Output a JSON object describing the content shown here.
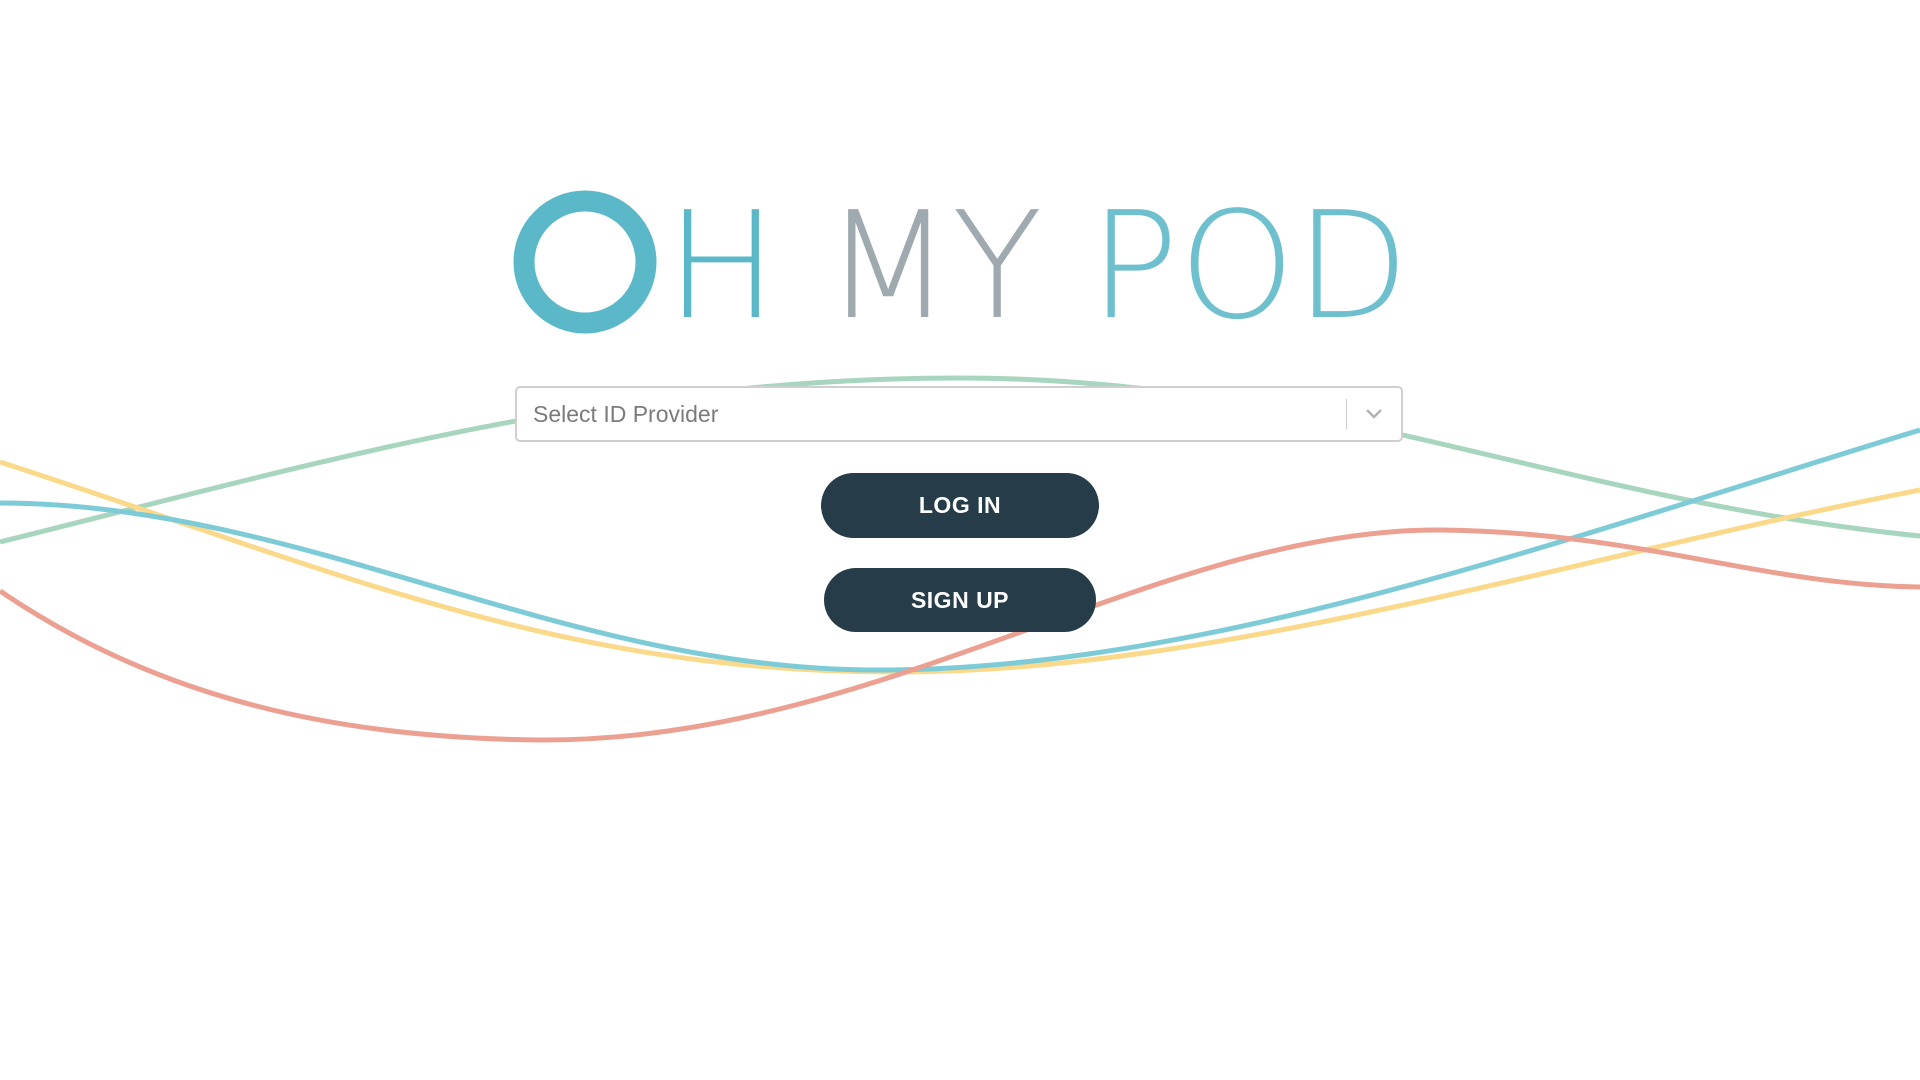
{
  "logo": {
    "letter_h": "H",
    "letters_my": "MY",
    "letters_pod": "POD!",
    "colors": {
      "primary": "#5bb8c9",
      "gray": "#9eaab0",
      "light": "#6fc0cf"
    }
  },
  "login_form": {
    "provider_select": {
      "placeholder": "Select ID Provider",
      "value": ""
    },
    "login_button": "LOG IN",
    "signup_button": "SIGN UP"
  },
  "background": {
    "wave_colors": {
      "green": "#a8d5be",
      "yellow": "#fbd98a",
      "blue": "#7ecbd8",
      "red": "#eba091"
    }
  },
  "colors": {
    "button_bg": "#263c48",
    "button_text": "#ffffff"
  }
}
